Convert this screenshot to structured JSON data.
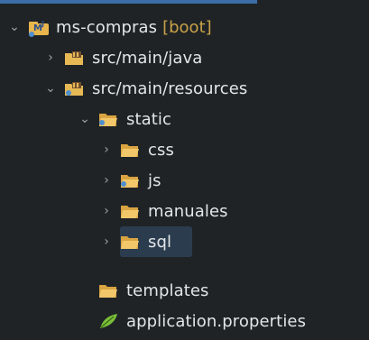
{
  "tree": {
    "project": {
      "name": "ms-compras",
      "tag": "[boot]",
      "icon": "maven-project-icon"
    },
    "items": [
      {
        "label": "src/main/java",
        "icon": "source-folder-icon",
        "expanded": false
      },
      {
        "label": "src/main/resources",
        "icon": "source-folder-icon",
        "expanded": true
      },
      {
        "label": "static",
        "icon": "folder-icon",
        "expanded": true
      },
      {
        "label": "css",
        "icon": "folder-icon",
        "expanded": false
      },
      {
        "label": "js",
        "icon": "folder-icon",
        "expanded": false
      },
      {
        "label": "manuales",
        "icon": "folder-icon",
        "expanded": false
      },
      {
        "label": "sql",
        "icon": "folder-icon",
        "expanded": false,
        "selected": true
      },
      {
        "label": "templates",
        "icon": "folder-icon"
      },
      {
        "label": "application.properties",
        "icon": "properties-file-icon"
      }
    ]
  }
}
